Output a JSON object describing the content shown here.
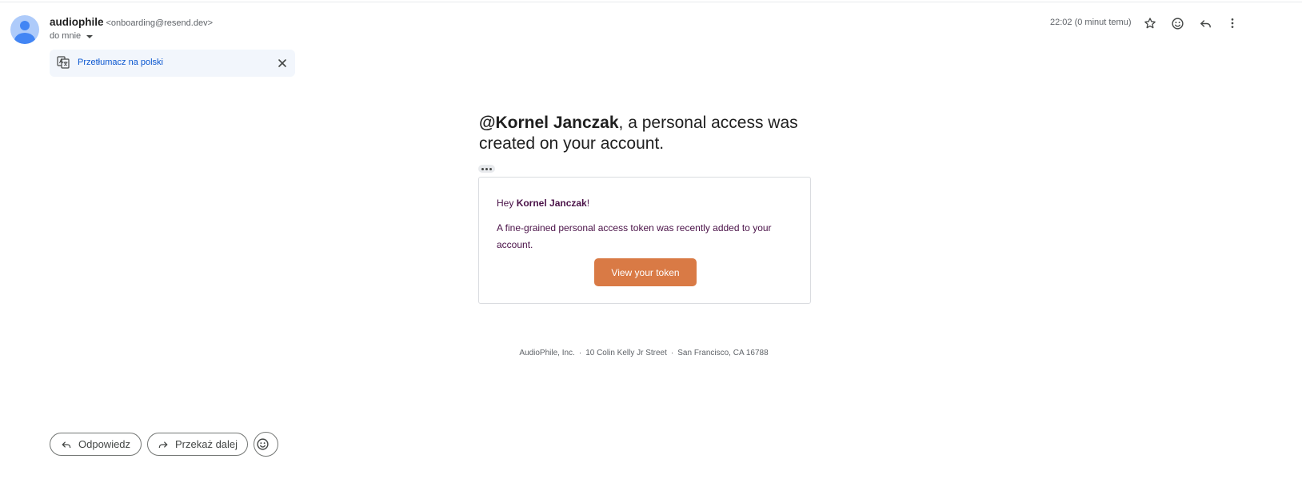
{
  "email": {
    "sender_name": "audiophile",
    "sender_email": "<onboarding@resend.dev>",
    "recipient_label": "do mnie",
    "timestamp": "22:02 (0 minut temu)"
  },
  "translate": {
    "label": "Przetłumacz na polski"
  },
  "body": {
    "headline_name": "@Kornel Janczak",
    "headline_rest": ", a personal access was created on your account.",
    "greeting_prefix": "Hey ",
    "greeting_name": "Kornel Janczak",
    "greeting_suffix": "!",
    "message": "A fine-grained personal access token was recently added to your account.",
    "button_label": "View your token",
    "footer_company": "AudioPhile, Inc.",
    "footer_street": "10 Colin Kelly Jr Street",
    "footer_city": "San Francisco, CA 16788",
    "footer_separator": "·"
  },
  "actions": {
    "reply_label": "Odpowiedz",
    "forward_label": "Przekaż dalej"
  },
  "icons": {
    "header": [
      "star-icon",
      "emoji-icon",
      "reply-icon",
      "more-vert-icon"
    ],
    "translate": "translate-icon",
    "close": "close-icon"
  },
  "colors": {
    "accent_button": "#d97a45",
    "link_blue": "#0b57d0",
    "body_text": "#4a1248",
    "avatar_bg": "#aecbfa",
    "avatar_fg": "#4285f4"
  }
}
